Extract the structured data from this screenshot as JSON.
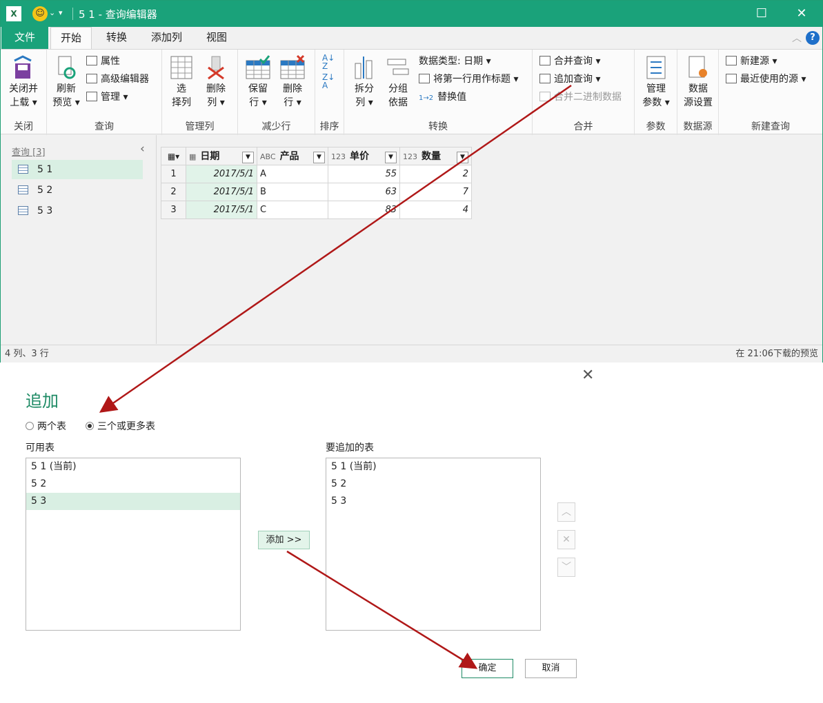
{
  "window": {
    "title": "5 1 - 查询编辑器",
    "app_icon": "excel-icon",
    "minimize": "—",
    "maximize": "☐",
    "close": "✕"
  },
  "tabs": [
    "文件",
    "开始",
    "转换",
    "添加列",
    "视图"
  ],
  "ribbon": {
    "close": {
      "big_label_1": "关闭并",
      "big_label_2": "上载 ▾",
      "group": "关闭"
    },
    "query": {
      "refresh_1": "刷新",
      "refresh_2": "预览 ▾",
      "properties": "属性",
      "advanced_editor": "高级编辑器",
      "manage": "管理 ▾",
      "group": "查询"
    },
    "manage_cols": {
      "choose_1": "选",
      "choose_2": "择列",
      "remove_1": "删除",
      "remove_2": "列 ▾",
      "group": "管理列"
    },
    "reduce_rows": {
      "keep_1": "保留",
      "keep_2": "行 ▾",
      "remove_1": "删除",
      "remove_2": "行 ▾",
      "group": "减少行"
    },
    "sort": {
      "group": "排序"
    },
    "transform": {
      "split_1": "拆分",
      "split_2": "列 ▾",
      "groupby_1": "分组",
      "groupby_2": "依据",
      "data_type": "数据类型: 日期 ▾",
      "first_row": "将第一行用作标题 ▾",
      "replace": "替换值",
      "group": "转换"
    },
    "combine": {
      "merge": "合并查询 ▾",
      "append": "追加查询 ▾",
      "combine_binary": "合并二进制数据",
      "group": "合并"
    },
    "params": {
      "manage_1": "管理",
      "manage_2": "参数 ▾",
      "group": "参数"
    },
    "datasource": {
      "settings_1": "数据",
      "settings_2": "源设置",
      "group": "数据源"
    },
    "new_query": {
      "new_source": "新建源 ▾",
      "recent": "最近使用的源 ▾",
      "group": "新建查询"
    }
  },
  "queries_panel": {
    "header": "查询 [3]",
    "items": [
      "5 1",
      "5 2",
      "5 3"
    ]
  },
  "table": {
    "columns": [
      {
        "type": "▦",
        "name": "日期"
      },
      {
        "type": "ABC",
        "name": "产品"
      },
      {
        "type": "123",
        "name": "单价"
      },
      {
        "type": "123",
        "name": "数量"
      }
    ],
    "rows": [
      [
        "1",
        "2017/5/1",
        "A",
        "55",
        "2"
      ],
      [
        "2",
        "2017/5/1",
        "B",
        "63",
        "7"
      ],
      [
        "3",
        "2017/5/1",
        "C",
        "83",
        "4"
      ]
    ]
  },
  "status": {
    "left": "4 列、3 行",
    "right": "在 21:06下载的预览"
  },
  "dialog": {
    "close": "✕",
    "title": "追加",
    "option_two": "两个表",
    "option_three": "三个或更多表",
    "available_label": "可用表",
    "available": [
      "5 1 (当前)",
      "5 2",
      "5 3"
    ],
    "append_label": "要追加的表",
    "to_append": [
      "5 1 (当前)",
      "5 2",
      "5 3"
    ],
    "add_button": "添加 >>",
    "ok": "确定",
    "cancel": "取消"
  }
}
